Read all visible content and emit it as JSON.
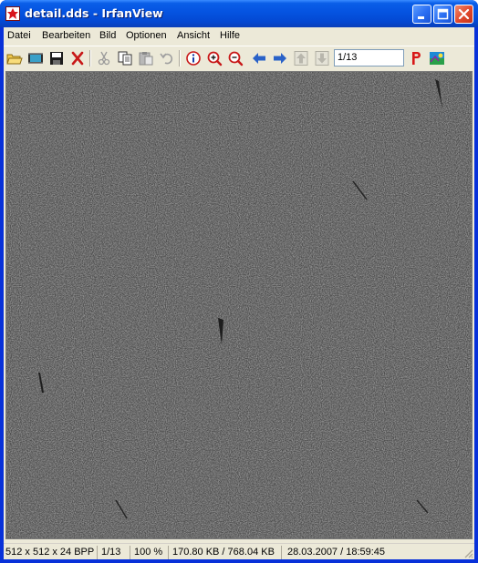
{
  "window": {
    "title": "detail.dds - IrfanView"
  },
  "menu": {
    "items": [
      "Datei",
      "Bearbeiten",
      "Bild",
      "Optionen",
      "Ansicht",
      "Hilfe"
    ]
  },
  "toolbar": {
    "page_value": "1/13",
    "icons": [
      "open-folder-icon",
      "slideshow-icon",
      "save-icon",
      "delete-icon",
      "cut-icon",
      "copy-icon",
      "paste-icon",
      "undo-icon",
      "info-icon",
      "zoom-in-icon",
      "zoom-out-icon",
      "previous-arrow-icon",
      "next-arrow-icon",
      "move-up-icon",
      "move-down-icon",
      "print-p-icon",
      "paint-icon"
    ]
  },
  "image": {
    "description_color": "#4a4a4a"
  },
  "statusbar": {
    "dimensions": "512 x 512 x 24 BPP",
    "page": "1/13",
    "zoom": "100 %",
    "size": "170.80 KB / 768.04 KB",
    "datetime": "28.03.2007 / 18:59:45"
  },
  "colors": {
    "titlebar": "#0553e0",
    "chrome": "#ece9d8",
    "close_button": "#e0462a"
  }
}
